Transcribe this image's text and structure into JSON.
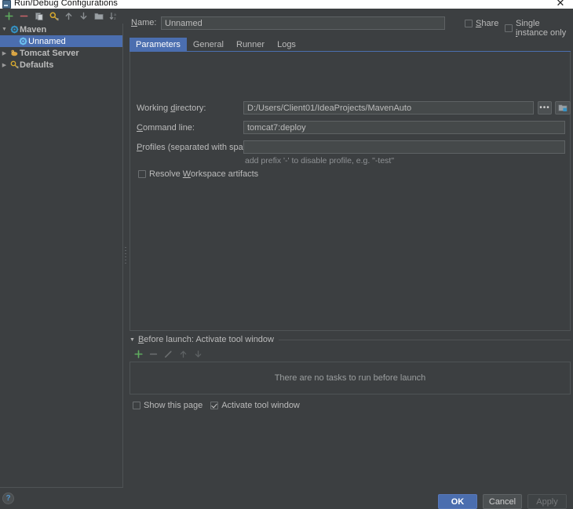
{
  "window": {
    "title": "Run/Debug Configurations",
    "close_label": "✕",
    "app_icon": "ide-window-icon"
  },
  "sidebar": {
    "toolbar": [
      {
        "name": "add-configuration-button",
        "icon": "plus-icon",
        "label": "+"
      },
      {
        "name": "remove-configuration-button",
        "icon": "minus-icon",
        "label": "−"
      },
      {
        "name": "copy-configuration-button",
        "icon": "copy-icon",
        "label": "Copy"
      },
      {
        "name": "save-configuration-button",
        "icon": "wrench-config-icon",
        "label": "Save Configuration"
      },
      {
        "name": "move-up-button",
        "icon": "arrow-up-icon",
        "label": "Move Up"
      },
      {
        "name": "move-down-button",
        "icon": "arrow-down-icon",
        "label": "Move Down"
      },
      {
        "name": "create-folder-button",
        "icon": "folder-icon",
        "label": "Create New Folder"
      },
      {
        "name": "sort-configurations-button",
        "icon": "sort-az-icon",
        "label": "Sort Configurations"
      }
    ],
    "tree": [
      {
        "label": "Maven",
        "icon": "maven-gear-icon",
        "expanded": true,
        "selected": false,
        "level": 0,
        "arrow": "▼"
      },
      {
        "label": "Unnamed",
        "icon": "maven-gear-icon",
        "expanded": false,
        "selected": true,
        "level": 1,
        "arrow": ""
      },
      {
        "label": "Tomcat Server",
        "icon": "tomcat-icon",
        "expanded": false,
        "selected": false,
        "level": 0,
        "arrow": "▶"
      },
      {
        "label": "Defaults",
        "icon": "defaults-icon",
        "expanded": false,
        "selected": false,
        "level": 0,
        "arrow": "▶"
      }
    ]
  },
  "main": {
    "name_label": "Name:",
    "name_value": "Unnamed",
    "share": {
      "label": "Share",
      "checked": false
    },
    "single_instance": {
      "label": "Single instance only",
      "checked": false
    },
    "tabs": [
      {
        "label": "Parameters",
        "active": true
      },
      {
        "label": "General",
        "active": false
      },
      {
        "label": "Runner",
        "active": false
      },
      {
        "label": "Logs",
        "active": false
      }
    ],
    "parameters": {
      "working_directory_label": "Working directory:",
      "working_directory_value": "D:/Users/Client01/IdeaProjects/MavenAuto",
      "browse_button_label": "•••",
      "module_button_icon": "module-folder-icon",
      "command_line_label": "Command line:",
      "command_line_value": "tomcat7:deploy",
      "profiles_label": "Profiles (separated with space):",
      "profiles_value": "",
      "profiles_hint": "add prefix '-' to disable profile, e.g. \"-test\"",
      "resolve_workspace": {
        "label": "Resolve Workspace artifacts",
        "checked": false
      }
    },
    "before_launch": {
      "arrow": "▼",
      "title": "Before launch: Activate tool window",
      "toolbar": [
        {
          "name": "add-task-button",
          "icon": "plus-icon",
          "label": "+"
        },
        {
          "name": "remove-task-button",
          "icon": "minus-icon",
          "label": "−"
        },
        {
          "name": "edit-task-button",
          "icon": "pencil-icon",
          "label": "Edit"
        },
        {
          "name": "task-move-up-button",
          "icon": "arrow-up-icon",
          "label": "Up"
        },
        {
          "name": "task-move-down-button",
          "icon": "arrow-down-icon",
          "label": "Down"
        }
      ],
      "empty_message": "There are no tasks to run before launch",
      "show_this_page": {
        "label": "Show this page",
        "checked": false
      },
      "activate_tool_window": {
        "label": "Activate tool window",
        "checked": true
      }
    }
  },
  "footer": {
    "help_label": "?",
    "ok_label": "OK",
    "cancel_label": "Cancel",
    "apply_label": "Apply"
  },
  "colors": {
    "accent": "#4b6eaf",
    "background": "#3c3f41",
    "field": "#45494a",
    "border": "#4f5355",
    "text": "#bbbbbb",
    "green": "#5fad5f",
    "red": "#c9656a"
  }
}
